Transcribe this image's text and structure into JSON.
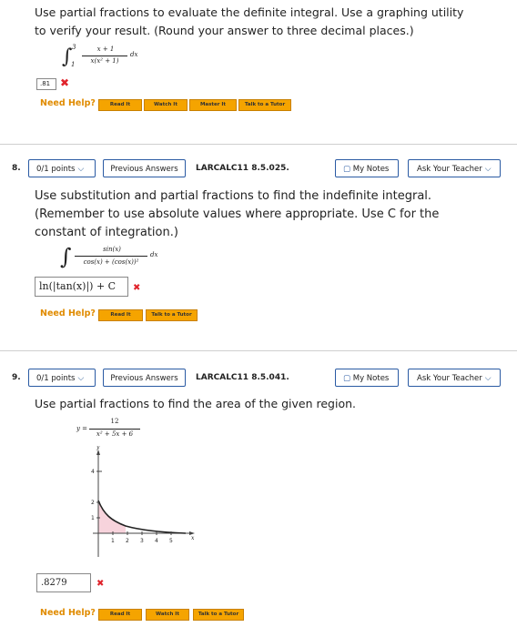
{
  "q7": {
    "text_line1": "Use partial fractions to evaluate the definite integral. Use a graphing utility",
    "text_line2": "to verify your result. (Round your answer to three decimal places.)",
    "integral": {
      "upper": "3",
      "lower": "1",
      "numerator": "x + 1",
      "denominator": "x(x² + 1)",
      "dx": "dx"
    },
    "answer": ".81",
    "need_help": "Need Help?",
    "buttons": [
      "Read It",
      "Watch It",
      "Master It",
      "Talk to a Tutor"
    ]
  },
  "q8": {
    "number": "8.",
    "points": "0/1 points",
    "previous": "Previous Answers",
    "code": "LARCALC11 8.5.025.",
    "my_notes": "My Notes",
    "ask_teacher": "Ask Your Teacher",
    "text_line1": "Use substitution and partial fractions to find the indefinite integral.",
    "text_line2": "(Remember to use absolute values where appropriate. Use C for the",
    "text_line3": "constant of integration.)",
    "integral": {
      "numerator": "sin(x)",
      "denominator": "cos(x) + (cos(x))²",
      "dx": "dx"
    },
    "answer": "ln(|tan(x)|) + C",
    "need_help": "Need Help?",
    "buttons": [
      "Read It",
      "Talk to a Tutor"
    ]
  },
  "q9": {
    "number": "9.",
    "points": "0/1 points",
    "previous": "Previous Answers",
    "code": "LARCALC11 8.5.041.",
    "my_notes": "My Notes",
    "ask_teacher": "Ask Your Teacher",
    "text": "Use partial fractions to find the area of the given region.",
    "equation": {
      "lhs": "y =",
      "numerator": "12",
      "denominator": "x² + 5x + 6"
    },
    "graph": {
      "y_label": "y",
      "x_label": "x",
      "y_ticks": [
        "4",
        "2",
        "1"
      ],
      "x_ticks": [
        "1",
        "2",
        "3",
        "4",
        "5"
      ]
    },
    "answer": ".8279",
    "need_help": "Need Help?",
    "buttons": [
      "Read It",
      "Watch It",
      "Talk to a Tutor"
    ]
  },
  "colors": {
    "accent_orange": "#f5a400",
    "error_red": "#e0242c",
    "button_border": "#2a5aa3",
    "shade_pink": "#f7d3dc"
  }
}
